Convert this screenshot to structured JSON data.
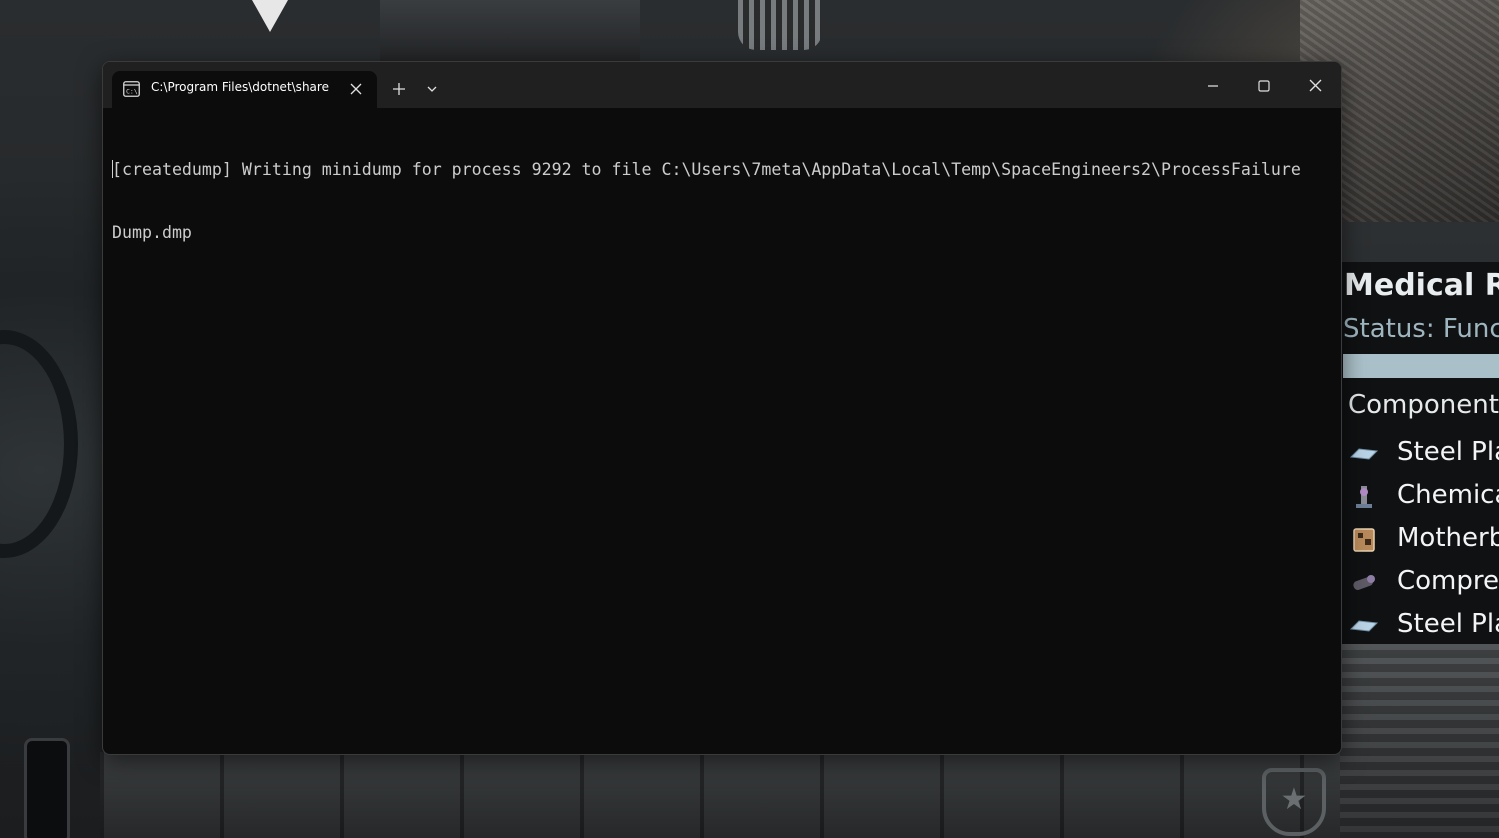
{
  "terminal": {
    "tab_title": "C:\\Program Files\\dotnet\\share",
    "tab_icon": "terminal-icon",
    "new_tab_label": "+",
    "output_lines": [
      "[createdump] Writing minidump for process 9292 to file C:\\Users\\7meta\\AppData\\Local\\Temp\\SpaceEngineers2\\ProcessFailure",
      "Dump.dmp"
    ]
  },
  "game_panel": {
    "title": "Medical Ro",
    "status": "Status: Func",
    "components_heading": "Component",
    "items": [
      {
        "label": "Steel Pla",
        "icon": "steel-plate-icon"
      },
      {
        "label": "Chemica",
        "icon": "chemical-icon"
      },
      {
        "label": "Motherb",
        "icon": "motherboard-icon"
      },
      {
        "label": "Compres",
        "icon": "compressor-icon"
      },
      {
        "label": "Steel Pla",
        "icon": "steel-plate-icon"
      }
    ]
  },
  "colors": {
    "terminal_bg": "#0c0c0c",
    "titlebar_bg": "#202020",
    "terminal_text": "#cccccc",
    "panel_status": "#9fb6c0",
    "panel_bar": "#aac0c8"
  }
}
